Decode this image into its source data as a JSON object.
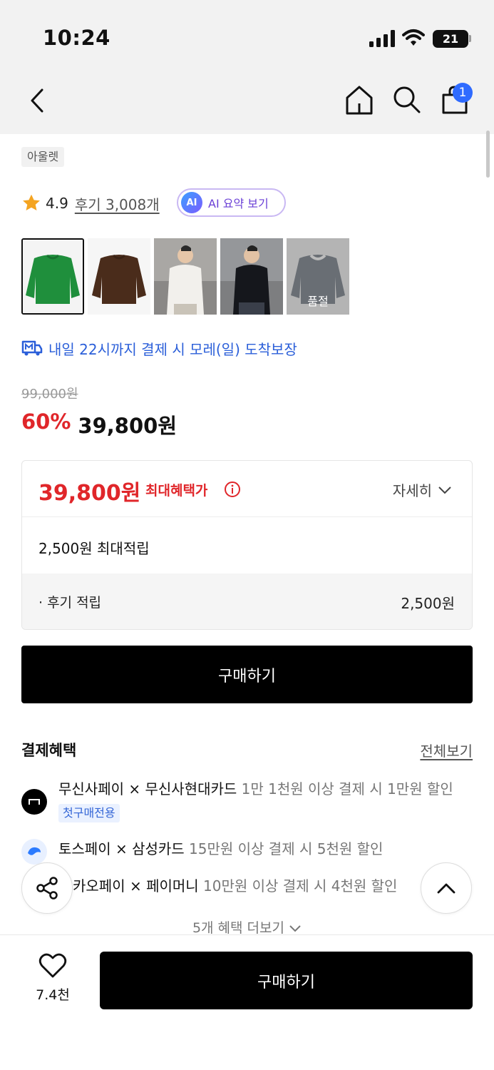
{
  "status": {
    "time": "10:24",
    "battery": "21"
  },
  "header": {
    "cart_count": "1"
  },
  "product": {
    "brand_tag": "아울렛",
    "rating": "4.9",
    "reviews_link": "후기 3,008개",
    "ai_badge": "AI",
    "ai_summary": "AI 요약 보기",
    "soldout_label": "품절",
    "delivery": "내일 22시까지 결제 시 모레(일) 도착보장",
    "original_price": "99,000원",
    "discount_pct": "60%",
    "price": "39,800원"
  },
  "benefit": {
    "max_price": "39,800원",
    "max_label": "최대혜택가",
    "detail": "자세히",
    "points_title": "2,500원 최대적립",
    "review_points_label": "· 후기 적립",
    "review_points_value": "2,500원"
  },
  "buy_button": "구매하기",
  "payment": {
    "title": "결제혜택",
    "view_all": "전체보기",
    "items": [
      {
        "name": "무신사페이 × 무신사현대카드",
        "desc": "1만 1천원 이상 결제 시 1만원 할인",
        "tag": "첫구매전용"
      },
      {
        "name": "토스페이 × 삼성카드",
        "desc": "15만원 이상 결제 시 5천원 할인"
      },
      {
        "name": "카오페이 × 페이머니",
        "desc": "10만원 이상 결제 시 4천원 할인"
      }
    ],
    "more": "5개 혜택 더보기"
  },
  "bottom": {
    "like_count": "7.4천",
    "buy_label": "구매하기"
  },
  "colors": {
    "accent_red": "#e0262a",
    "link_blue": "#2b5fd9",
    "ai_purple": "#6a3fd6",
    "badge_blue": "#2f6bff"
  }
}
